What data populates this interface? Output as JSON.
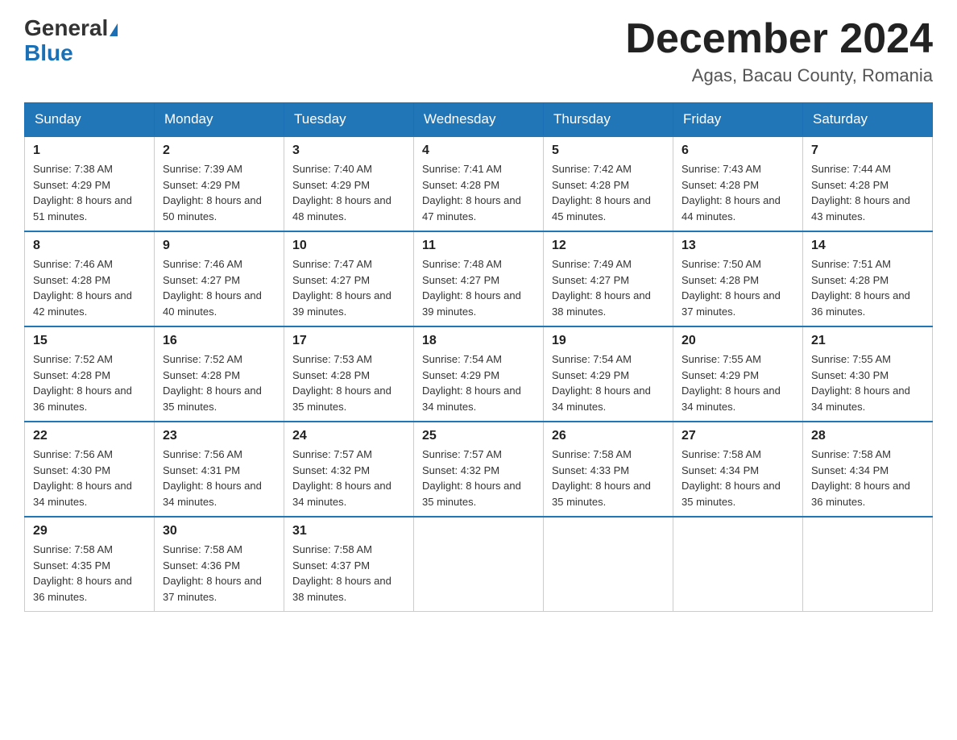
{
  "header": {
    "logo_general": "General",
    "logo_blue": "Blue",
    "title": "December 2024",
    "location": "Agas, Bacau County, Romania"
  },
  "days_of_week": [
    "Sunday",
    "Monday",
    "Tuesday",
    "Wednesday",
    "Thursday",
    "Friday",
    "Saturday"
  ],
  "weeks": [
    [
      {
        "day": 1,
        "sunrise": "7:38 AM",
        "sunset": "4:29 PM",
        "daylight": "8 hours and 51 minutes."
      },
      {
        "day": 2,
        "sunrise": "7:39 AM",
        "sunset": "4:29 PM",
        "daylight": "8 hours and 50 minutes."
      },
      {
        "day": 3,
        "sunrise": "7:40 AM",
        "sunset": "4:29 PM",
        "daylight": "8 hours and 48 minutes."
      },
      {
        "day": 4,
        "sunrise": "7:41 AM",
        "sunset": "4:28 PM",
        "daylight": "8 hours and 47 minutes."
      },
      {
        "day": 5,
        "sunrise": "7:42 AM",
        "sunset": "4:28 PM",
        "daylight": "8 hours and 45 minutes."
      },
      {
        "day": 6,
        "sunrise": "7:43 AM",
        "sunset": "4:28 PM",
        "daylight": "8 hours and 44 minutes."
      },
      {
        "day": 7,
        "sunrise": "7:44 AM",
        "sunset": "4:28 PM",
        "daylight": "8 hours and 43 minutes."
      }
    ],
    [
      {
        "day": 8,
        "sunrise": "7:46 AM",
        "sunset": "4:28 PM",
        "daylight": "8 hours and 42 minutes."
      },
      {
        "day": 9,
        "sunrise": "7:46 AM",
        "sunset": "4:27 PM",
        "daylight": "8 hours and 40 minutes."
      },
      {
        "day": 10,
        "sunrise": "7:47 AM",
        "sunset": "4:27 PM",
        "daylight": "8 hours and 39 minutes."
      },
      {
        "day": 11,
        "sunrise": "7:48 AM",
        "sunset": "4:27 PM",
        "daylight": "8 hours and 39 minutes."
      },
      {
        "day": 12,
        "sunrise": "7:49 AM",
        "sunset": "4:27 PM",
        "daylight": "8 hours and 38 minutes."
      },
      {
        "day": 13,
        "sunrise": "7:50 AM",
        "sunset": "4:28 PM",
        "daylight": "8 hours and 37 minutes."
      },
      {
        "day": 14,
        "sunrise": "7:51 AM",
        "sunset": "4:28 PM",
        "daylight": "8 hours and 36 minutes."
      }
    ],
    [
      {
        "day": 15,
        "sunrise": "7:52 AM",
        "sunset": "4:28 PM",
        "daylight": "8 hours and 36 minutes."
      },
      {
        "day": 16,
        "sunrise": "7:52 AM",
        "sunset": "4:28 PM",
        "daylight": "8 hours and 35 minutes."
      },
      {
        "day": 17,
        "sunrise": "7:53 AM",
        "sunset": "4:28 PM",
        "daylight": "8 hours and 35 minutes."
      },
      {
        "day": 18,
        "sunrise": "7:54 AM",
        "sunset": "4:29 PM",
        "daylight": "8 hours and 34 minutes."
      },
      {
        "day": 19,
        "sunrise": "7:54 AM",
        "sunset": "4:29 PM",
        "daylight": "8 hours and 34 minutes."
      },
      {
        "day": 20,
        "sunrise": "7:55 AM",
        "sunset": "4:29 PM",
        "daylight": "8 hours and 34 minutes."
      },
      {
        "day": 21,
        "sunrise": "7:55 AM",
        "sunset": "4:30 PM",
        "daylight": "8 hours and 34 minutes."
      }
    ],
    [
      {
        "day": 22,
        "sunrise": "7:56 AM",
        "sunset": "4:30 PM",
        "daylight": "8 hours and 34 minutes."
      },
      {
        "day": 23,
        "sunrise": "7:56 AM",
        "sunset": "4:31 PM",
        "daylight": "8 hours and 34 minutes."
      },
      {
        "day": 24,
        "sunrise": "7:57 AM",
        "sunset": "4:32 PM",
        "daylight": "8 hours and 34 minutes."
      },
      {
        "day": 25,
        "sunrise": "7:57 AM",
        "sunset": "4:32 PM",
        "daylight": "8 hours and 35 minutes."
      },
      {
        "day": 26,
        "sunrise": "7:58 AM",
        "sunset": "4:33 PM",
        "daylight": "8 hours and 35 minutes."
      },
      {
        "day": 27,
        "sunrise": "7:58 AM",
        "sunset": "4:34 PM",
        "daylight": "8 hours and 35 minutes."
      },
      {
        "day": 28,
        "sunrise": "7:58 AM",
        "sunset": "4:34 PM",
        "daylight": "8 hours and 36 minutes."
      }
    ],
    [
      {
        "day": 29,
        "sunrise": "7:58 AM",
        "sunset": "4:35 PM",
        "daylight": "8 hours and 36 minutes."
      },
      {
        "day": 30,
        "sunrise": "7:58 AM",
        "sunset": "4:36 PM",
        "daylight": "8 hours and 37 minutes."
      },
      {
        "day": 31,
        "sunrise": "7:58 AM",
        "sunset": "4:37 PM",
        "daylight": "8 hours and 38 minutes."
      },
      null,
      null,
      null,
      null
    ]
  ]
}
